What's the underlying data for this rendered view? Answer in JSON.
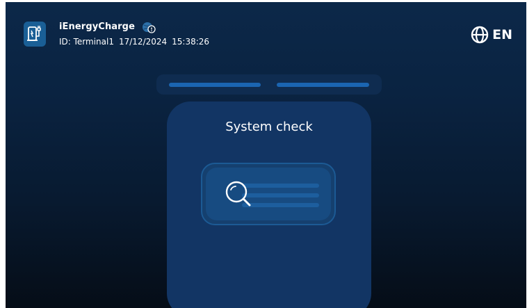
{
  "header": {
    "app_name": "iEnergyCharge",
    "terminal_id": "ID: Terminal1",
    "date": "17/12/2024",
    "time": "15:38:26",
    "logo_icon": "ev-charger-icon",
    "status_icon": "globe-alert-icon"
  },
  "language": {
    "code": "EN",
    "icon": "globe-icon"
  },
  "progress": {
    "steps_total": 2,
    "steps_active": 2
  },
  "main": {
    "title": "System check",
    "icon": "magnifier-icon"
  },
  "colors": {
    "background_top": "#0c2849",
    "background_bottom": "#050d17",
    "accent": "#1b65b1",
    "card": "#123564",
    "text": "#ffffff"
  }
}
